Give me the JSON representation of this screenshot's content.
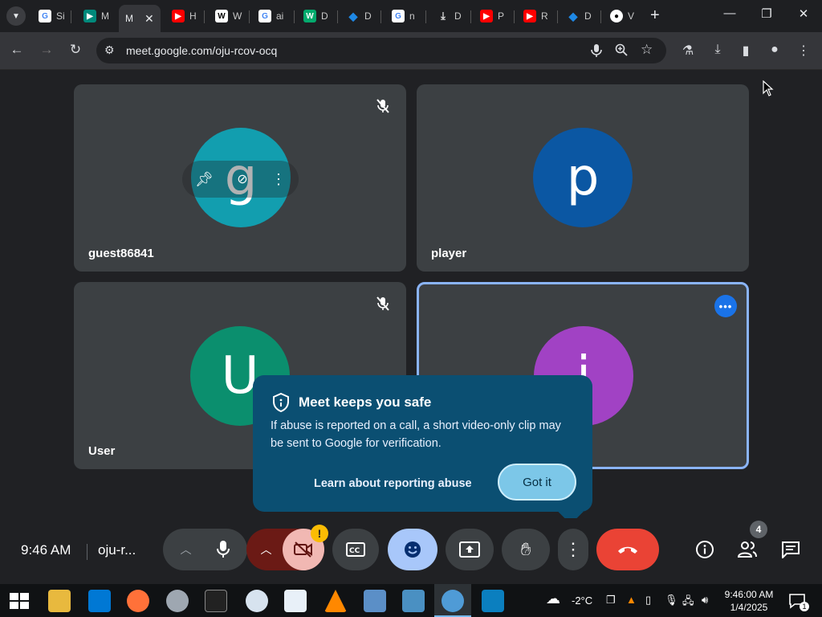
{
  "browser": {
    "tabs": [
      {
        "label": "Si",
        "icon": "google-icon",
        "color": "#ffffff"
      },
      {
        "label": "M",
        "icon": "meet-icon",
        "color": "#00897b"
      },
      {
        "label": "M",
        "icon": "meet-icon",
        "color": "#00897b",
        "active": true
      },
      {
        "label": "H",
        "icon": "youtube-icon",
        "color": "#ff0000"
      },
      {
        "label": "W",
        "icon": "wikipedia-icon",
        "color": "#ffffff"
      },
      {
        "label": "ai",
        "icon": "google-icon",
        "color": "#ffffff"
      },
      {
        "label": "D",
        "icon": "w3-icon",
        "color": "#04aa6d"
      },
      {
        "label": "D",
        "icon": "diamond-icon",
        "color": "#1e88e5"
      },
      {
        "label": "n",
        "icon": "google-icon",
        "color": "#ffffff"
      },
      {
        "label": "D",
        "icon": "download-icon",
        "color": "#dddddd"
      },
      {
        "label": "P",
        "icon": "youtube-icon",
        "color": "#ff0000"
      },
      {
        "label": "R",
        "icon": "youtube-icon",
        "color": "#ff0000"
      },
      {
        "label": "D",
        "icon": "diamond-icon",
        "color": "#1e88e5"
      },
      {
        "label": "V",
        "icon": "github-icon",
        "color": "#ffffff"
      }
    ],
    "url": "meet.google.com/oju-rcov-ocq"
  },
  "tiles": [
    {
      "name": "guest86841",
      "initial": "g",
      "avatar_color": "#129eaf",
      "muted": true
    },
    {
      "name": "player",
      "initial": "p",
      "avatar_color": "#0b57a3",
      "muted": false
    },
    {
      "name": "User",
      "initial": "U",
      "avatar_color": "#0b8f6e",
      "muted": true
    },
    {
      "name": "",
      "initial": "i",
      "avatar_color": "#a142c4",
      "muted": false,
      "active": true
    }
  ],
  "popup": {
    "title": "Meet keeps you safe",
    "body": "If abuse is reported on a call, a short video-only clip may be sent to Google for verification.",
    "link": "Learn about reporting abuse",
    "button": "Got it"
  },
  "controls": {
    "time": "9:46 AM",
    "meeting_code": "oju-r...",
    "camera_warning": "!",
    "people_count": "4",
    "end_call_color": "#ea4335"
  },
  "taskbar": {
    "weather": "-2°C",
    "time": "9:46:00 AM",
    "date": "1/4/2025",
    "notifications": "1"
  }
}
